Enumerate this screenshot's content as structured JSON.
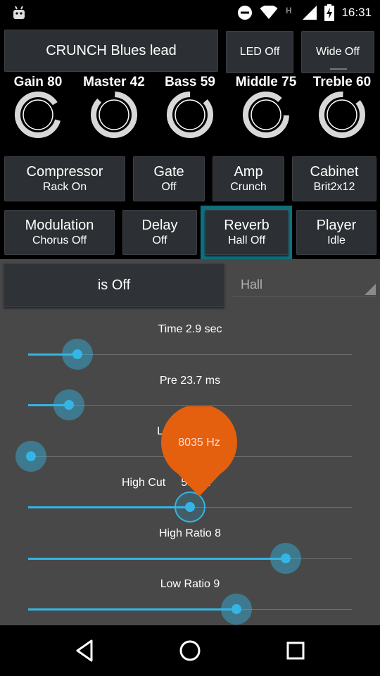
{
  "status_bar": {
    "time": "16:31",
    "icons": [
      "android-icon",
      "dnd-icon",
      "wifi-icon",
      "h-signal-icon",
      "cell-signal-icon",
      "battery-charging-icon"
    ]
  },
  "header": {
    "preset_name": "CRUNCH Blues lead",
    "led_button": "LED Off",
    "wide_button": "Wide Off"
  },
  "knobs": [
    {
      "label": "Gain 80",
      "value": 80
    },
    {
      "label": "Master 42",
      "value": 42
    },
    {
      "label": "Bass 59",
      "value": 59
    },
    {
      "label": "Middle 75",
      "value": 75
    },
    {
      "label": "Treble 60",
      "value": 60
    }
  ],
  "modules_row1": [
    {
      "name": "Compressor",
      "state": "Rack On"
    },
    {
      "name": "Gate",
      "state": "Off"
    },
    {
      "name": "Amp",
      "state": "Crunch"
    },
    {
      "name": "Cabinet",
      "state": "Brit2x12"
    }
  ],
  "modules_row2": [
    {
      "name": "Modulation",
      "state": "Chorus Off"
    },
    {
      "name": "Delay",
      "state": "Off"
    },
    {
      "name": "Reverb",
      "state": "Hall Off"
    },
    {
      "name": "Player",
      "state": "Idle"
    }
  ],
  "reverb_panel": {
    "onoff_label": "is Off",
    "type_selected": "Hall",
    "sliders": [
      {
        "label": "Time 2.9 sec",
        "fraction": 0.145
      },
      {
        "label": "Pre 23.7 ms",
        "fraction": 0.12
      },
      {
        "label": "Lo",
        "fraction": 0.0
      },
      {
        "label": "High Cut",
        "label_tail": "55 Hz",
        "fraction": 0.5
      },
      {
        "label": "High Ratio 8",
        "fraction": 0.8
      },
      {
        "label": "Low Ratio 9",
        "fraction": 0.645
      }
    ],
    "balloon_value": "8035 Hz"
  },
  "colors": {
    "accent": "#33b5e5",
    "selected_frame": "#0f6f7d",
    "balloon": "#e4600e",
    "panel": "#484848",
    "button": "#2c2f33"
  }
}
